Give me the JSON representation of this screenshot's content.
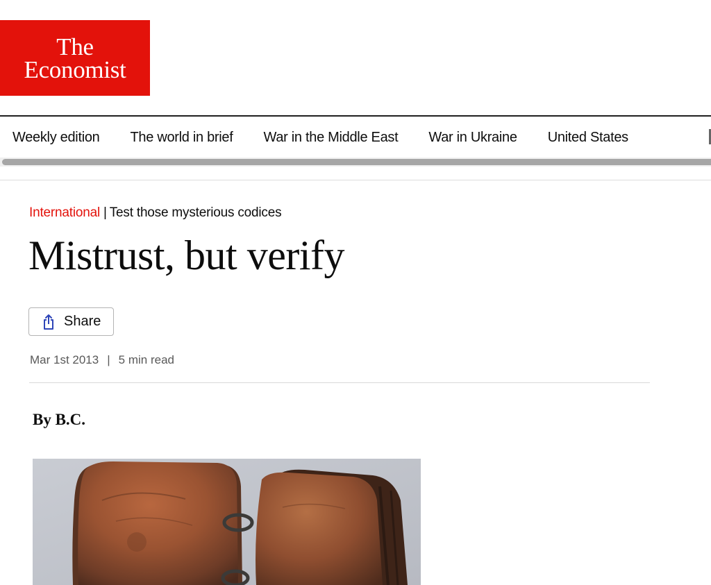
{
  "logo": {
    "line1": "The",
    "line2": "Economist",
    "bg_color": "#e3120b"
  },
  "nav": {
    "items": [
      {
        "label": "Weekly edition"
      },
      {
        "label": "The world in brief"
      },
      {
        "label": "War in the Middle East"
      },
      {
        "label": "War in Ukraine"
      },
      {
        "label": "United States"
      }
    ]
  },
  "article": {
    "section": "International",
    "separator": "|",
    "flytitle": "Test those mysterious codices",
    "headline": "Mistrust, but verify",
    "share_label": "Share",
    "date": "Mar 1st 2013",
    "meta_divider": "|",
    "read_time": "5 min read",
    "byline": "By B.C."
  },
  "colors": {
    "accent": "#e3120b",
    "share_icon": "#2e45b8",
    "meta_text": "#595959"
  },
  "icons": {
    "share": "share-icon"
  }
}
